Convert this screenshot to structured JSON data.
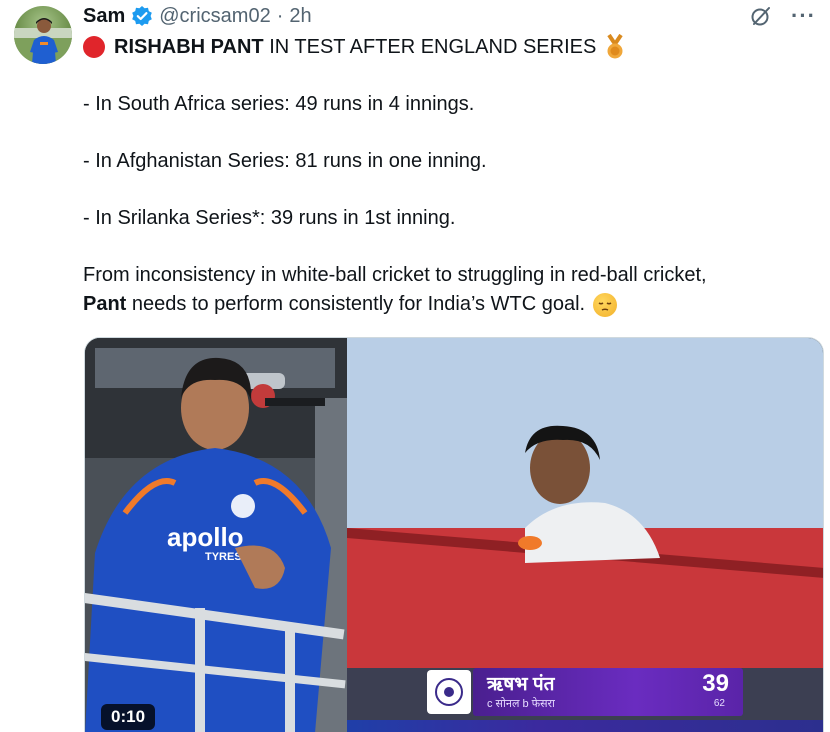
{
  "author": {
    "name": "Sam",
    "handle": "@cricsam02",
    "separator": "·",
    "time": "2h",
    "verified_icon": "verified-badge-icon"
  },
  "actions": {
    "grok_icon": "grok-icon",
    "more_label": "···"
  },
  "tweet": {
    "headline_bold": "RISHABH PANT",
    "headline_rest": " IN TEST AFTER ENGLAND SERIES",
    "line1": "- In South Africa series: 49 runs in 4 innings.",
    "line2": "- In Afghanistan Series: 81 runs in one inning.",
    "line3": "- In Srilanka Series*: 39 runs in 1st inning.",
    "para_line1": "From inconsistency in white-ball cricket to struggling in red-ball cricket,",
    "para_bold": "Pant",
    "para_rest": " needs to perform consistently for India’s WTC goal."
  },
  "media": {
    "video_time": "0:10",
    "jersey_text": "apollo",
    "jersey_subtext": "TYRES",
    "scorecard": {
      "player": "ऋषभ पंत",
      "dismissal": "c सोनल b फेसरा",
      "runs": "39",
      "balls": "62"
    }
  },
  "colors": {
    "text": "#0f1419",
    "secondary": "#536471",
    "verified": "#1d9bf0",
    "red_dot": "#e0252b",
    "scorecard": "#5a24a8"
  }
}
